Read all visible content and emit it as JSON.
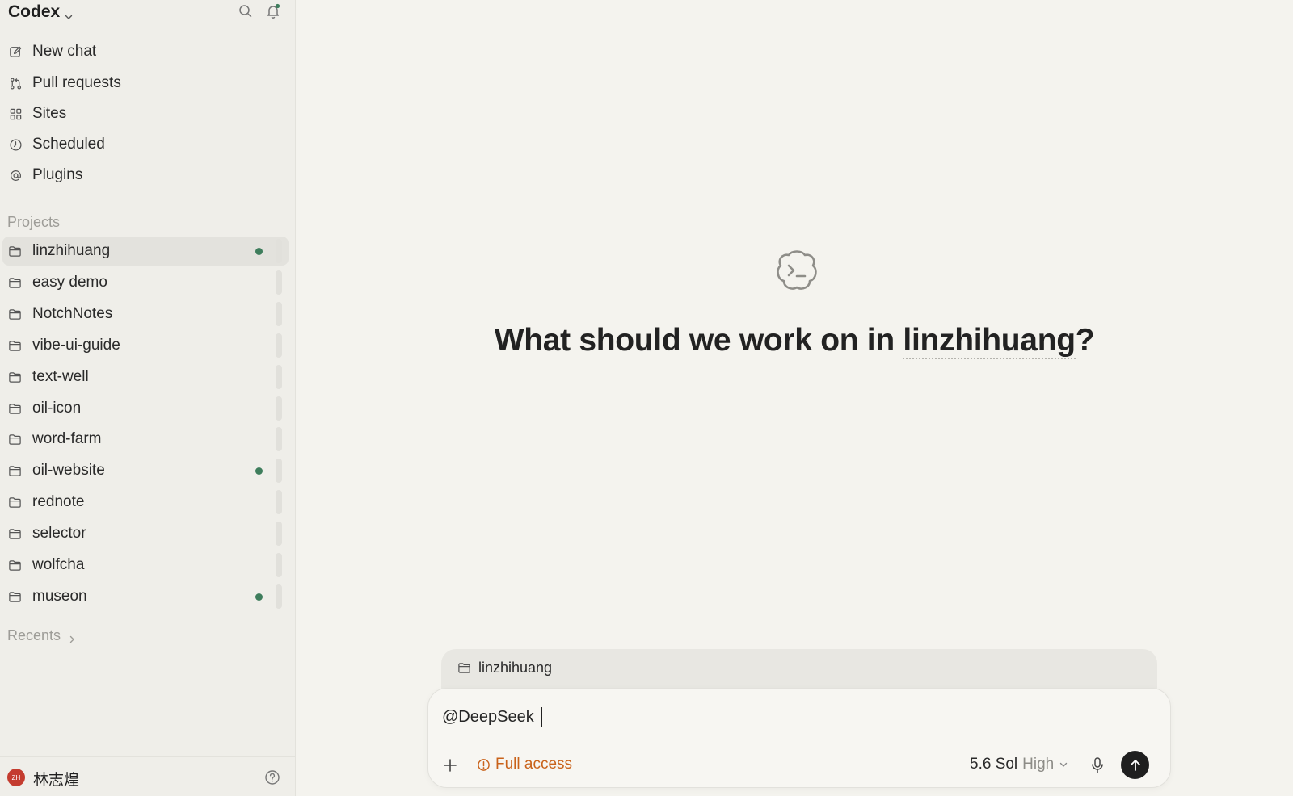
{
  "app": {
    "title": "Codex"
  },
  "sidebar": {
    "nav": [
      {
        "label": "New chat",
        "icon": "edit-icon"
      },
      {
        "label": "Pull requests",
        "icon": "pull-request-icon"
      },
      {
        "label": "Sites",
        "icon": "grid-icon"
      },
      {
        "label": "Scheduled",
        "icon": "clock-icon"
      },
      {
        "label": "Plugins",
        "icon": "at-icon"
      }
    ],
    "projects_label": "Projects",
    "projects": [
      {
        "label": "linzhihuang",
        "active": true,
        "dot": true
      },
      {
        "label": "easy demo",
        "active": false,
        "dot": false
      },
      {
        "label": "NotchNotes",
        "active": false,
        "dot": false
      },
      {
        "label": "vibe-ui-guide",
        "active": false,
        "dot": false
      },
      {
        "label": "text-well",
        "active": false,
        "dot": false
      },
      {
        "label": "oil-icon",
        "active": false,
        "dot": false
      },
      {
        "label": "word-farm",
        "active": false,
        "dot": false
      },
      {
        "label": "oil-website",
        "active": false,
        "dot": true
      },
      {
        "label": "rednote",
        "active": false,
        "dot": false
      },
      {
        "label": "selector",
        "active": false,
        "dot": false
      },
      {
        "label": "wolfcha",
        "active": false,
        "dot": false
      },
      {
        "label": "museon",
        "active": false,
        "dot": true
      }
    ],
    "recents_label": "Recents",
    "user": {
      "initials": "ZH",
      "name": "林志煌"
    }
  },
  "main": {
    "headline_prefix": "What should we work on in ",
    "headline_project": "linzhihuang",
    "headline_suffix": "?",
    "context_project": "linzhihuang",
    "composer": {
      "value": "@DeepSeek",
      "access_label": "Full access",
      "model_name": "5.6 Sol",
      "model_level": "High"
    }
  },
  "colors": {
    "background": "#f4f3ee",
    "sidebar": "#efeee9",
    "status_dot": "#3e7d5c",
    "access": "#c9621a",
    "avatar": "#c43c2f"
  }
}
